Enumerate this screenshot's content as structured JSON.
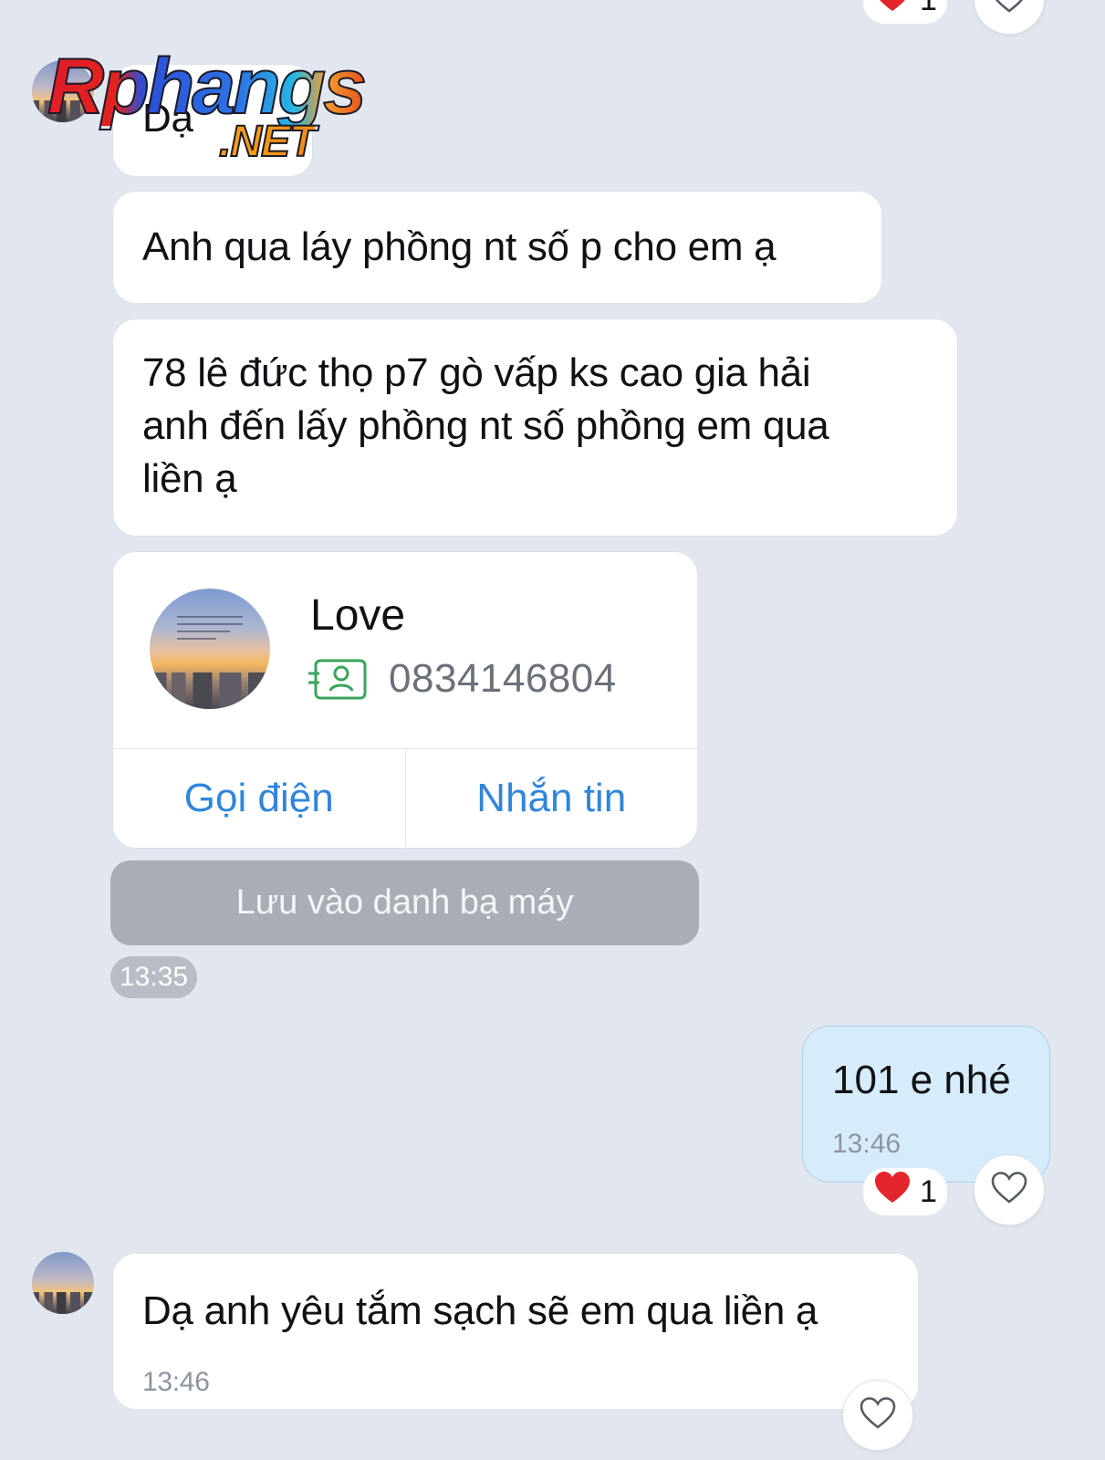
{
  "top_reaction": {
    "heart": "❤",
    "count": "1"
  },
  "watermark": {
    "main": "Rphangs",
    "sub": ".NET"
  },
  "messages": [
    {
      "text": "Dạ"
    },
    {
      "text": "Anh qua láy phồng nt số p cho em ạ"
    },
    {
      "line1": "78 lê đức thọ p7 gò vấp ks cao gia hải",
      "line2": "anh đến lấy phồng nt số phồng em qua",
      "line3": "liền ạ"
    }
  ],
  "contact_card": {
    "name": "Love",
    "phone": "0834146804",
    "call_label": "Gọi điện",
    "message_label": "Nhắn tin",
    "save_label": "Lưu vào danh bạ máy",
    "time": "13:35"
  },
  "own_message": {
    "text": "101 e nhé",
    "time": "13:46",
    "reaction_count": "1"
  },
  "last_message": {
    "text": "Dạ anh yêu tắm sạch sẽ em qua liền ạ",
    "time": "13:46"
  },
  "colors": {
    "background": "#e2e7ef",
    "accent": "#2f86dc",
    "own_bubble": "#d6ecfb",
    "heart": "#e3262d",
    "contact_icon": "#3aa45a"
  }
}
